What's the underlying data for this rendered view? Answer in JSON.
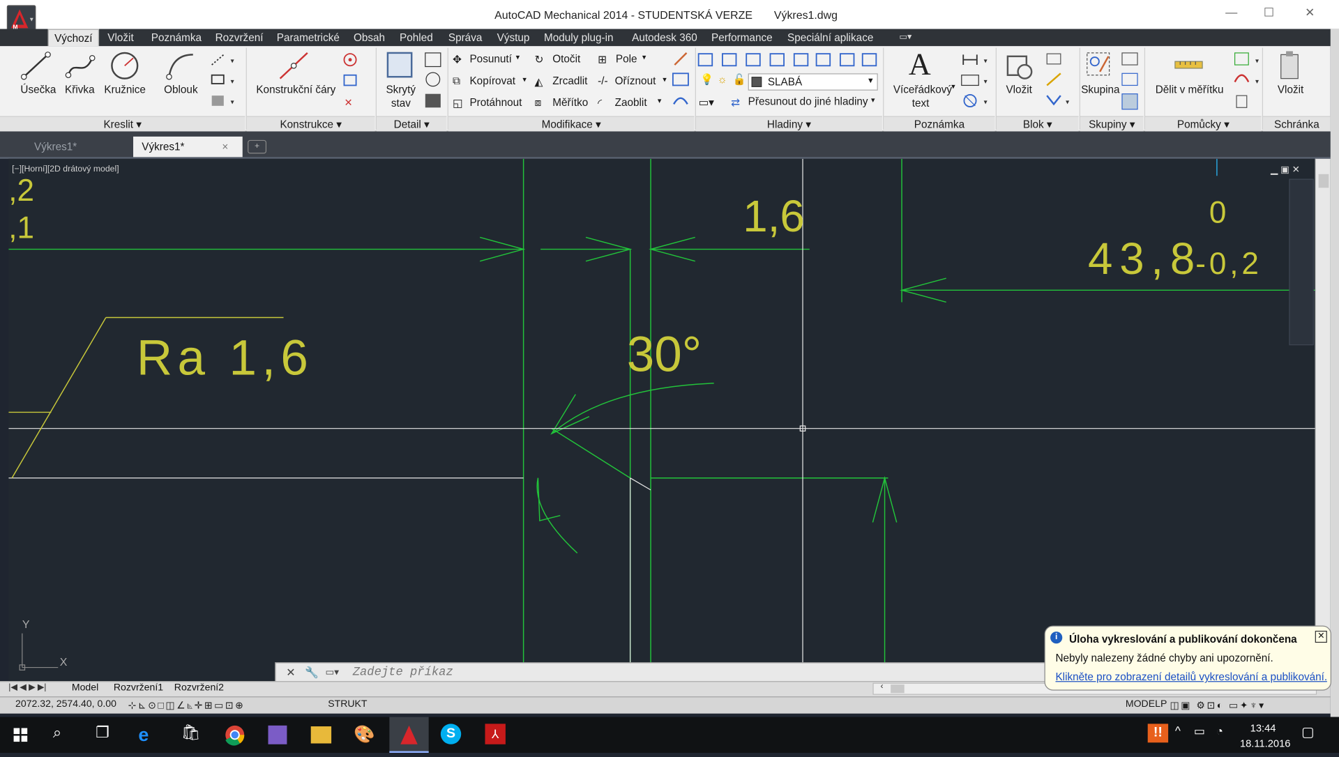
{
  "app": {
    "title": "AutoCAD Mechanical 2014 - STUDENTSKÁ VERZE",
    "file": "Výkres1.dwg",
    "app_button_letter": "M"
  },
  "menu": {
    "tabs": [
      "Výchozí",
      "Vložit",
      "Poznámka",
      "Rozvržení",
      "Parametrické",
      "Obsah",
      "Pohled",
      "Správa",
      "Výstup",
      "Moduly plug-in",
      "Autodesk 360",
      "Performance",
      "Speciální aplikace"
    ],
    "active": "Výchozí"
  },
  "ribbon": {
    "draw": {
      "usecka": "Úsečka",
      "krivka": "Křivka",
      "kruznice": "Kružnice",
      "oblouk": "Oblouk",
      "group": "Kreslit"
    },
    "construct": {
      "lines": "Konstrukční čáry",
      "group": "Konstrukce"
    },
    "detail": {
      "hidden_line1": "Skrytý",
      "hidden_line2": "stav",
      "group": "Detail"
    },
    "modify": {
      "move": "Posunutí",
      "rotate": "Otočit",
      "array": "Pole",
      "copy": "Kopírovat",
      "mirror": "Zrcadlit",
      "trim": "Oříznout",
      "stretch": "Protáhnout",
      "scale": "Měřítko",
      "fillet": "Zaoblit",
      "group": "Modifikace"
    },
    "layers": {
      "current_layer": "SLABÁ",
      "move_to_layer": "Přesunout do jiné hladiny",
      "group": "Hladiny"
    },
    "annotation": {
      "mtext_line1": "Víceřádkový",
      "mtext_line2": "text",
      "group": "Poznámka"
    },
    "block": {
      "insert": "Vložit",
      "group": "Blok"
    },
    "groups": {
      "group_btn": "Skupina",
      "group": "Skupiny"
    },
    "utilities": {
      "measure": "Dělit v měřítku",
      "group": "Pomůcky"
    },
    "clipboard": {
      "paste": "Vložit",
      "group": "Schránka"
    }
  },
  "doc_tabs": {
    "tab1": "Výkres1*",
    "tab2": "Výkres1*",
    "close": "×"
  },
  "viewport": {
    "label": "[−][Horní][2D drátový model]",
    "text_2": ",2",
    "text_1": ",1",
    "dim_1_6": "1,6",
    "tol_upper": "0",
    "dim_main": "43,8",
    "tol_lower": "-0,2",
    "roughness": "Ra 1,6",
    "angle": "30°",
    "ucs_y": "Y",
    "ucs_x": "X"
  },
  "command": {
    "placeholder": "Zadejte příkaz"
  },
  "layout_tabs": [
    "Model",
    "Rozvržení1",
    "Rozvržení2"
  ],
  "status": {
    "coords": "2072.32, 2574.40, 0.00",
    "strukt": "STRUKT",
    "modelp": "MODELP"
  },
  "notification": {
    "title": "Úloha vykreslování a publikování dokončena",
    "body": "Nebyly nalezeny žádné chyby ani upozornění.",
    "link": "Klikněte pro zobrazení detailů vykreslování a publikování..."
  },
  "taskbar": {
    "time": "13:44",
    "date": "18.11.2016"
  },
  "colors": {
    "green": "#22c33a",
    "yellow": "#c8c83a",
    "white": "#e8e8e8",
    "canvas": "#212830"
  }
}
